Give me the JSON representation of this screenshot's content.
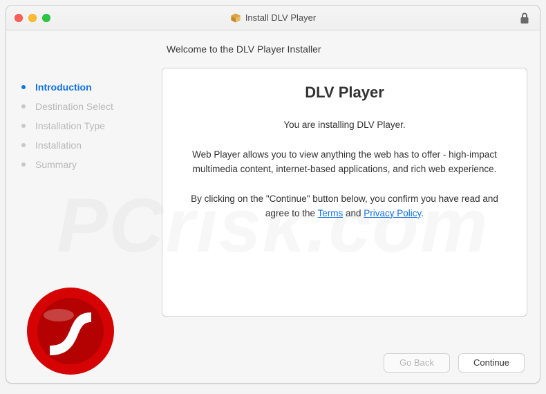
{
  "window": {
    "title": "Install DLV Player"
  },
  "header": {
    "welcome": "Welcome to the DLV Player Installer"
  },
  "sidebar": {
    "steps": [
      {
        "label": "Introduction",
        "active": true
      },
      {
        "label": "Destination Select",
        "active": false
      },
      {
        "label": "Installation Type",
        "active": false
      },
      {
        "label": "Installation",
        "active": false
      },
      {
        "label": "Summary",
        "active": false
      }
    ]
  },
  "content": {
    "title": "DLV Player",
    "para1": "You are installing DLV Player.",
    "para2": "Web Player allows you to view anything the web has to offer - high-impact multimedia content, internet-based applications, and rich web experience.",
    "consent_prefix": "By clicking on the \"Continue\" button below, you confirm you have read and agree to the ",
    "terms_label": "Terms",
    "and_label": " and ",
    "privacy_label": "Privacy Policy",
    "period": "."
  },
  "footer": {
    "back_label": "Go Back",
    "continue_label": "Continue"
  },
  "watermark": "PCrisk.com"
}
